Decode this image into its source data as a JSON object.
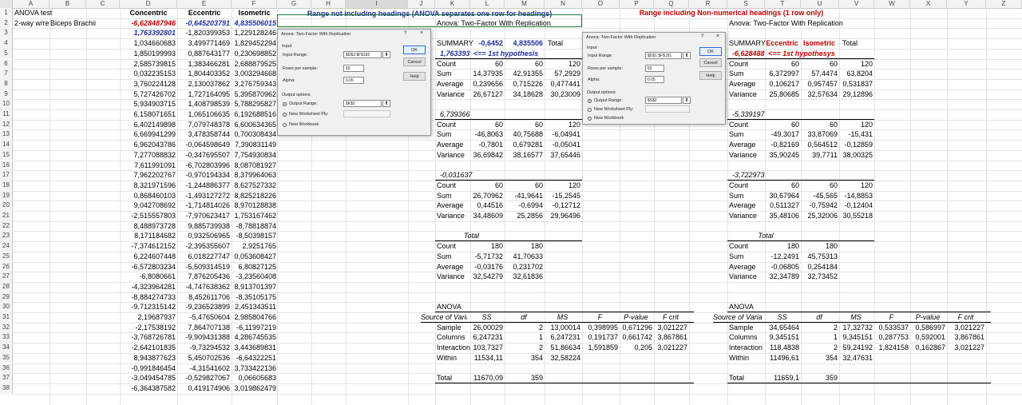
{
  "columns": [
    "A",
    "B",
    "C",
    "D",
    "E",
    "F",
    "G",
    "H",
    "I",
    "J",
    "K",
    "L",
    "M",
    "N",
    "O",
    "P",
    "Q",
    "R",
    "S",
    "T",
    "U",
    "V",
    "W",
    "X",
    "Y",
    "Z"
  ],
  "rows": [
    "1",
    "2",
    "3",
    "4",
    "5",
    "6",
    "7",
    "8",
    "9",
    "10",
    "11",
    "12",
    "13",
    "14",
    "15",
    "16",
    "17",
    "18",
    "19",
    "20",
    "21",
    "22",
    "23",
    "24",
    "25",
    "26",
    "27",
    "28",
    "29",
    "30",
    "31",
    "32",
    "33",
    "34",
    "35",
    "36",
    "37",
    "38"
  ],
  "a1": "ANOVA test",
  "a2": "2-way w/re",
  "b2": "Biceps Brachii",
  "headers": {
    "concentric": "Concentric",
    "eccentric": "Eccentric",
    "isometric": "Isometric"
  },
  "range_note_left": "Range not including headings (ANOVA separates one row for headings)",
  "range_note_right": "Range including Non-numerical headings (1 row only)",
  "data_rows": [
    [
      "-6,628487946",
      "-0,645203791",
      "4,835506015"
    ],
    [
      "1,763392801",
      "-1,820399353",
      "1,229128246"
    ],
    [
      "1,034660683",
      "3,499771469",
      "1,829452294"
    ],
    [
      "1,850199993",
      "0,887643177",
      "0,230698852"
    ],
    [
      "2,585739815",
      "1,383466281",
      "2,688879525"
    ],
    [
      "0,032235153",
      "1,804403352",
      "3,003294668"
    ],
    [
      "3,760224128",
      "2,130037862",
      "3,276759343"
    ],
    [
      "5,727426702",
      "1,727164095",
      "5,395870962"
    ],
    [
      "5,934903715",
      "1,408798539",
      "5,788295827"
    ],
    [
      "6,158071651",
      "1,065106635",
      "6,192688516"
    ],
    [
      "6,402149898",
      "7,079748378",
      "6,600634365"
    ],
    [
      "6,669941299",
      "3,478358744",
      "0,700308434"
    ],
    [
      "6,962043786",
      "-0,064598649",
      "7,390831149"
    ],
    [
      "7,277088832",
      "-0,347695507",
      "7,754930834"
    ],
    [
      "7,611991091",
      "-6,702803996",
      "8,087081927"
    ],
    [
      "7,962202767",
      "-0,970194334",
      "8,379964063"
    ],
    [
      "8,321971596",
      "-1,244886377",
      "8,627527332"
    ],
    [
      "0,868460103",
      "-1,493127272",
      "8,825218226"
    ],
    [
      "9,042708692",
      "-1,714814026",
      "8,970128838"
    ],
    [
      "-2,515557803",
      "-7,970623417",
      "1,753167462"
    ],
    [
      "8,488973728",
      "9,885739938",
      "-8,78818874"
    ],
    [
      "8,171184682",
      "0,932506965",
      "-8,50398157"
    ],
    [
      "-7,374612152",
      "-2,395355607",
      "2,9251765"
    ],
    [
      "6,224607448",
      "6,018227747",
      "0,053608427"
    ],
    [
      "-6,572803234",
      "-5,509314519",
      "6,80827125"
    ],
    [
      "-6,8080661",
      "7,876205436",
      "-3,23560408"
    ],
    [
      "-4,323964281",
      "-4,747638362",
      "8,913701397"
    ],
    [
      "-8,884274733",
      "8,452611706",
      "-8,35105175"
    ],
    [
      "-9,712315142",
      "-9,236523899",
      "2,451343511"
    ],
    [
      "2,19687937",
      "-5,47650604",
      "2,985804766"
    ],
    [
      "-2,17538192",
      "7,864707138",
      "-6,11997219"
    ],
    [
      "-3,768726781",
      "-9,909431388",
      "4,286745535"
    ],
    [
      "-2,642101835",
      "-9,73294532",
      "3,443689831"
    ],
    [
      "8,943877623",
      "5,450702536",
      "-6,64322251"
    ],
    [
      "-0,991846454",
      "-4,31541602",
      "3,733422136"
    ],
    [
      "-3,049454785",
      "-0,529827067",
      "0,06605683"
    ],
    [
      "-6,364387582",
      "0,419174906",
      "3,019862479"
    ]
  ],
  "left_anova": {
    "title": "Anova: Two-Factor With Replication",
    "summary_label": "SUMMARY",
    "summary_h1": "-0,6452",
    "summary_h2": "4,835506",
    "summary_h3": "Total",
    "hyp_value": "1,763393",
    "hyp_note": "<== 1st hypothesis",
    "groups": [
      {
        "label": "",
        "count": [
          "60",
          "60",
          "120"
        ],
        "sum": [
          "14,37935",
          "42,91355",
          "57,2929"
        ],
        "average": [
          "0,239656",
          "0,715226",
          "0,477441"
        ],
        "variance": [
          "26,67127",
          "34,18628",
          "30,23009"
        ]
      },
      {
        "label": "6,739366",
        "count": [
          "60",
          "60",
          "120"
        ],
        "sum": [
          "-46,8063",
          "40,75688",
          "-6,04941"
        ],
        "average": [
          "-0,7801",
          "0,679281",
          "-0,05041"
        ],
        "variance": [
          "36,69842",
          "38,16577",
          "37,65446"
        ]
      },
      {
        "label": "-0,031637",
        "count": [
          "60",
          "60",
          "120"
        ],
        "sum": [
          "26,70962",
          "-41,9641",
          "-15,2545"
        ],
        "average": [
          "0,44516",
          "-0,6994",
          "-0,12712"
        ],
        "variance": [
          "34,48609",
          "25,2856",
          "29,96496"
        ]
      }
    ],
    "total": {
      "label": "Total",
      "count": [
        "180",
        "180"
      ],
      "sum": [
        "-5,71732",
        "41,70633"
      ],
      "average": [
        "-0,03176",
        "0,231702"
      ],
      "variance": [
        "32,54279",
        "32,61836"
      ]
    },
    "anova_label": "ANOVA",
    "anova_headers": [
      "Source of Variation",
      "SS",
      "df",
      "MS",
      "F",
      "P-value",
      "F crit"
    ],
    "anova_rows": [
      [
        "Sample",
        "26,00029",
        "2",
        "13,00014",
        "0,398995",
        "0,671296",
        "3,021227"
      ],
      [
        "Columns",
        "6,247231",
        "1",
        "6,247231",
        "0,191737",
        "0,661742",
        "3,867861"
      ],
      [
        "Interaction",
        "103,7327",
        "2",
        "51,86634",
        "1,591859",
        "0,205",
        "3,021227"
      ],
      [
        "Within",
        "11534,11",
        "354",
        "32,58224",
        "",
        "",
        ""
      ]
    ],
    "anova_total": [
      "Total",
      "11670,09",
      "359"
    ]
  },
  "right_anova": {
    "title": "Anova: Two-Factor With Replication",
    "summary_label": "SUMMARY",
    "summary_h1": "Eccentric",
    "summary_h2": "Isometric",
    "summary_h3": "Total",
    "hyp_value": "-6,628488",
    "hyp_note": "<== 1st hypothesys",
    "groups": [
      {
        "label": "",
        "count": [
          "60",
          "60",
          "120"
        ],
        "sum": [
          "6,372997",
          "57,4474",
          "63,8204"
        ],
        "average": [
          "0,106217",
          "0,957457",
          "0,531837"
        ],
        "variance": [
          "25,80685",
          "32,57634",
          "29,12896"
        ]
      },
      {
        "label": "-5,339197",
        "count": [
          "60",
          "60",
          "120"
        ],
        "sum": [
          "-49,3017",
          "33,87069",
          "-15,431"
        ],
        "average": [
          "-0,82169",
          "0,564512",
          "-0,12859"
        ],
        "variance": [
          "35,90245",
          "39,7711",
          "38,00325"
        ]
      },
      {
        "label": "-3,722973",
        "count": [
          "60",
          "60",
          "120"
        ],
        "sum": [
          "30,67964",
          "-45,565",
          "-14,8853"
        ],
        "average": [
          "0,511327",
          "-0,75942",
          "-0,12404"
        ],
        "variance": [
          "35,48106",
          "25,32006",
          "30,55218"
        ]
      }
    ],
    "total": {
      "label": "Total",
      "count": [
        "180",
        "180"
      ],
      "sum": [
        "-12,2491",
        "45,75313"
      ],
      "average": [
        "-0,06805",
        "0,254184"
      ],
      "variance": [
        "32,34789",
        "32,73452"
      ]
    },
    "anova_label": "ANOVA",
    "anova_headers": [
      "Source of Variation",
      "SS",
      "df",
      "MS",
      "F",
      "P-value",
      "F crit"
    ],
    "anova_rows": [
      [
        "Sample",
        "34,65464",
        "2",
        "17,32732",
        "0,533537",
        "0,586997",
        "3,021227"
      ],
      [
        "Columns",
        "9,345151",
        "1",
        "9,345151",
        "0,287753",
        "0,592001",
        "3,867861"
      ],
      [
        "Interaction",
        "118,4838",
        "2",
        "59,24192",
        "1,824158",
        "0,162867",
        "3,021227"
      ],
      [
        "Within",
        "11496,61",
        "354",
        "32,47631",
        "",
        "",
        ""
      ]
    ],
    "anova_total": [
      "Total",
      "11659,1",
      "359"
    ]
  },
  "row_labels": {
    "count": "Count",
    "sum": "Sum",
    "average": "Average",
    "variance": "Variance"
  },
  "dialog_left": {
    "title": "Anova: Two-Factor With Replication",
    "help_q": "?",
    "close": "×",
    "input_section": "Input",
    "input_range_label": "Input Range:",
    "input_range_value": "$D$2:$F$182",
    "rows_per_sample_label": "Rows per sample:",
    "rows_per_sample_value": "60",
    "alpha_label": "Alpha:",
    "alpha_value": "0,05",
    "output_section": "Output options",
    "output_range_label": "Output Range:",
    "output_range_value": "$K$2",
    "new_ws_label": "New Worksheet Ply:",
    "new_wb_label": "New Workbook",
    "ok": "OK",
    "cancel": "Cancel",
    "help": "Help"
  },
  "dialog_right": {
    "title": "Anova: Two-Factor With Replication",
    "help_q": "?",
    "close": "×",
    "input_section": "Input",
    "input_range_label": "Input Range:",
    "input_range_value": "$D$1:$F$181",
    "rows_per_sample_label": "Rows per sample:",
    "rows_per_sample_value": "60",
    "alpha_label": "Alpha:",
    "alpha_value": "0,05",
    "output_section": "Output options",
    "output_range_label": "Output Range:",
    "output_range_value": "$S$2",
    "new_ws_label": "New Worksheet Ply:",
    "new_wb_label": "New Workbook",
    "ok": "OK",
    "cancel": "Cancel",
    "help": "Help"
  },
  "arrow_glyph": "⬆"
}
